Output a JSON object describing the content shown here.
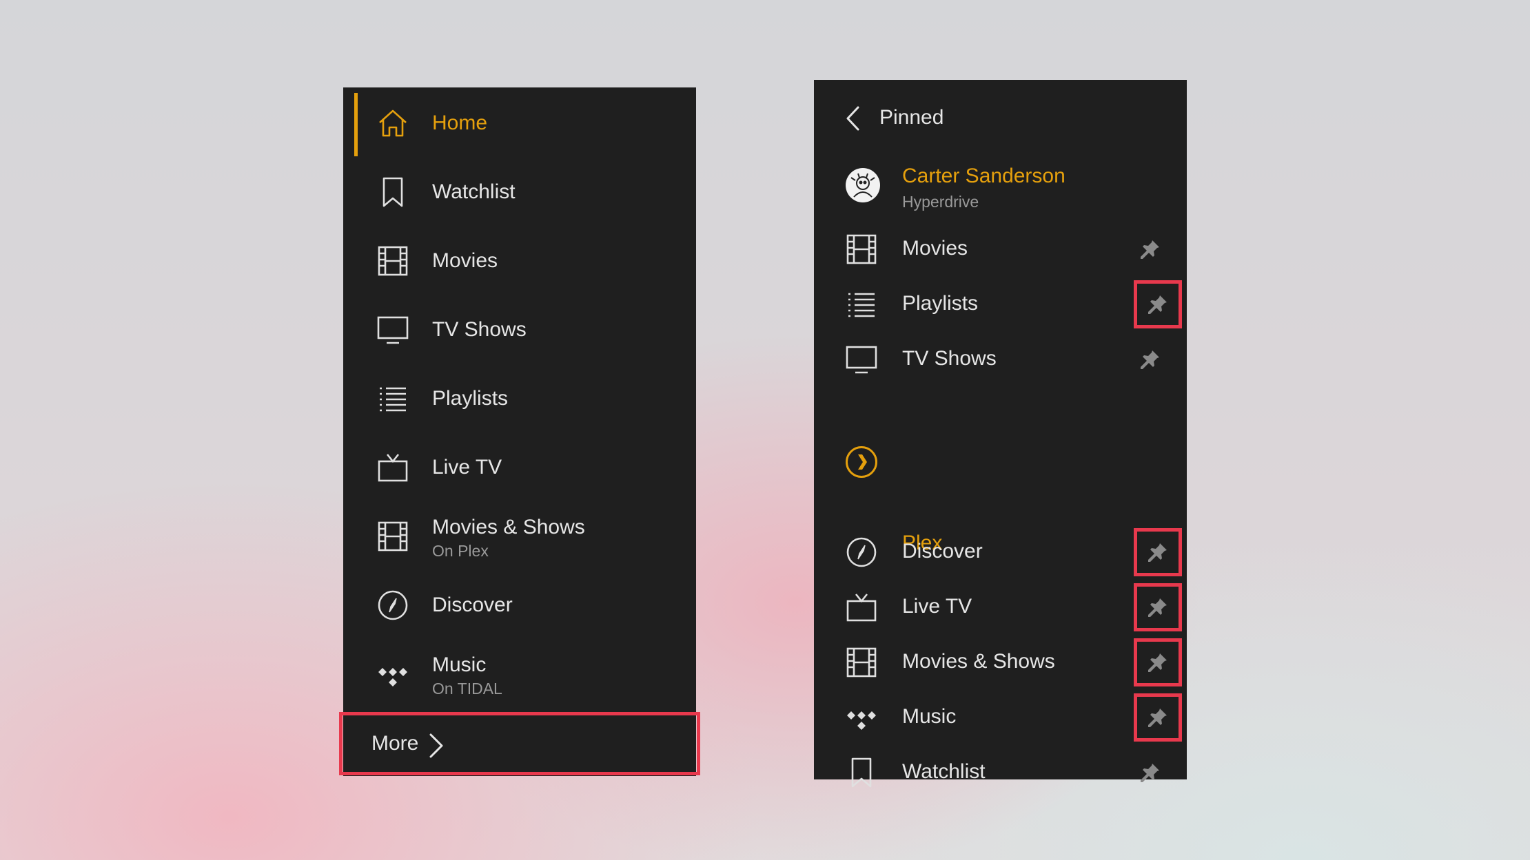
{
  "left_menu": {
    "items": [
      {
        "label": "Home",
        "sub": "",
        "icon": "home-icon",
        "active": true
      },
      {
        "label": "Watchlist",
        "sub": "",
        "icon": "bookmark-icon"
      },
      {
        "label": "Movies",
        "sub": "",
        "icon": "film-icon"
      },
      {
        "label": "TV Shows",
        "sub": "",
        "icon": "monitor-icon"
      },
      {
        "label": "Playlists",
        "sub": "",
        "icon": "list-icon"
      },
      {
        "label": "Live TV",
        "sub": "",
        "icon": "tv-icon"
      },
      {
        "label": "Movies & Shows",
        "sub": "On Plex",
        "icon": "film-icon"
      },
      {
        "label": "Discover",
        "sub": "",
        "icon": "compass-icon"
      },
      {
        "label": "Music",
        "sub": "On TIDAL",
        "icon": "tidal-icon"
      }
    ],
    "more_label": "More"
  },
  "right_menu": {
    "header": "Pinned",
    "server": {
      "name": "Carter Sanderson",
      "subtitle": "Hyperdrive"
    },
    "server_items": [
      {
        "label": "Movies",
        "icon": "film-icon",
        "highlighted": false
      },
      {
        "label": "Playlists",
        "icon": "list-icon",
        "highlighted": true
      },
      {
        "label": "TV Shows",
        "icon": "monitor-icon",
        "highlighted": false
      }
    ],
    "plex_section": "Plex",
    "plex_items": [
      {
        "label": "Discover",
        "icon": "compass-icon",
        "highlighted": true
      },
      {
        "label": "Live TV",
        "icon": "tv-icon",
        "highlighted": true
      },
      {
        "label": "Movies & Shows",
        "icon": "film-icon",
        "highlighted": true
      },
      {
        "label": "Music",
        "icon": "tidal-icon",
        "highlighted": true
      },
      {
        "label": "Watchlist",
        "icon": "bookmark-icon",
        "highlighted": false
      }
    ]
  },
  "colors": {
    "accent": "#e5a00d",
    "highlight": "#e8394d",
    "panel": "#1f1f1f",
    "text": "#e6e6e6",
    "subtext": "#9a9a9a"
  }
}
